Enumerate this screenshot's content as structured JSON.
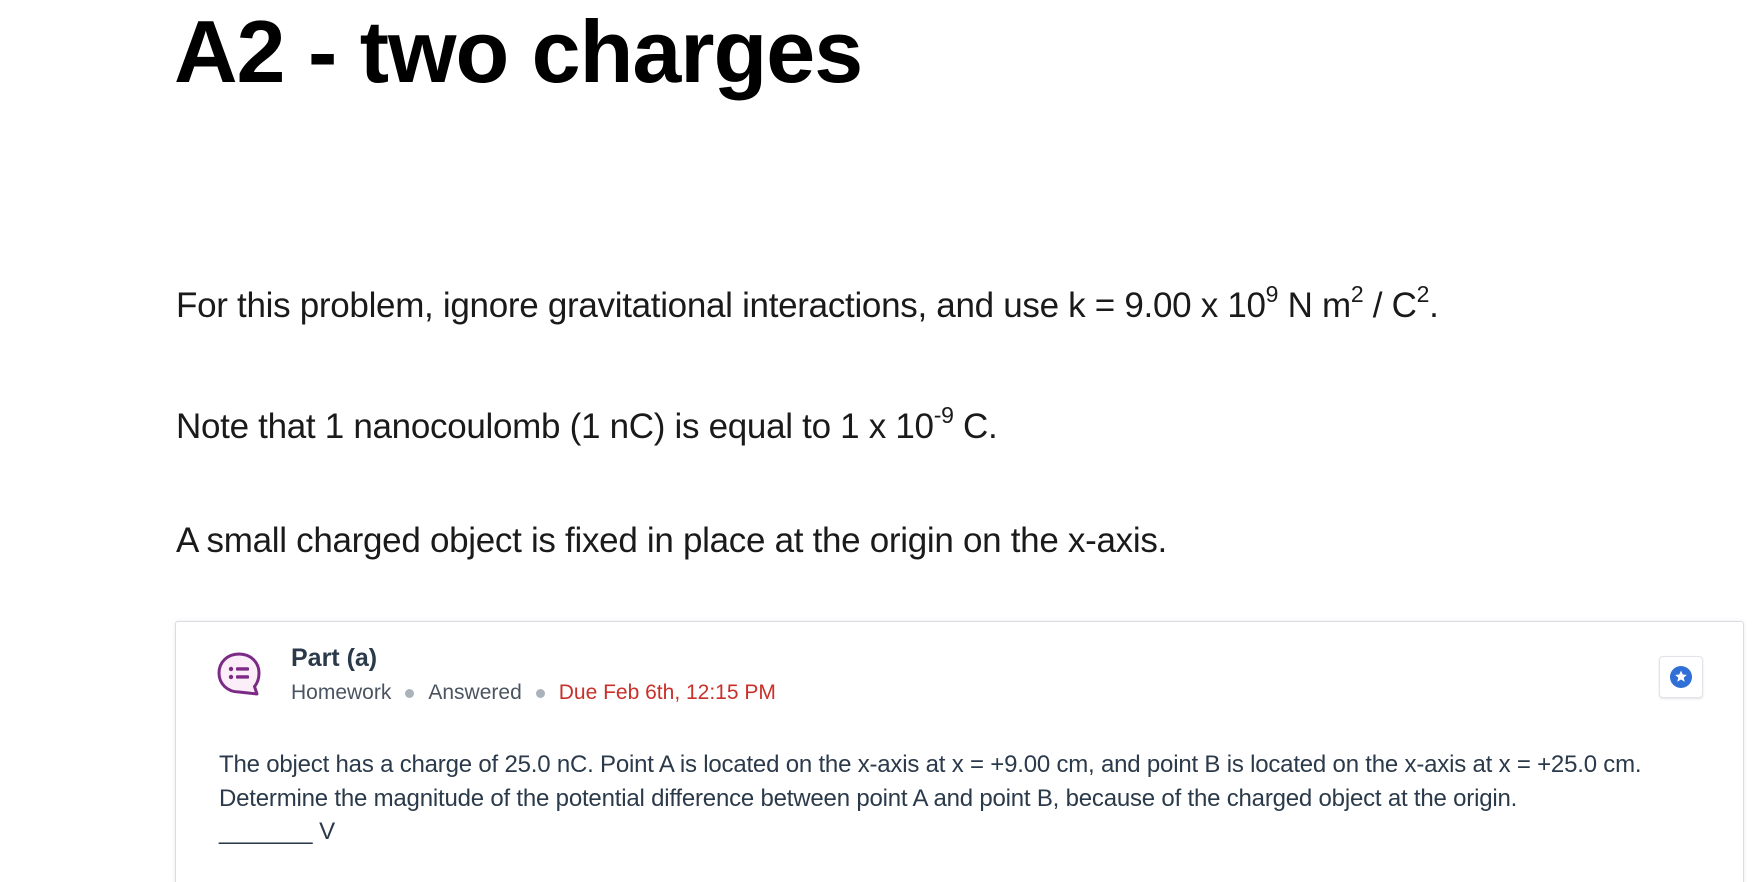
{
  "page": {
    "title": "A2 - two charges",
    "intro": {
      "p1_text": "For this problem, ignore gravitational interactions, and use k = 9.00 x 10",
      "p1_exp1": "9",
      "p1_mid": " N m",
      "p1_exp2": "2",
      "p1_mid2": " / C",
      "p1_exp3": "2",
      "p1_end": ".",
      "p2_text": "Note that 1 nanocoulomb (1 nC) is equal to 1 x 10",
      "p2_exp": "-9",
      "p2_end": " C.",
      "p3_text": "A small charged object is fixed in place at the origin on the x-axis."
    }
  },
  "part": {
    "title": "Part (a)",
    "type": "Homework",
    "status": "Answered",
    "due": "Due Feb 6th, 12:15 PM",
    "icon": "question-bubble-icon",
    "star_icon": "star-badge-icon",
    "question": "The object has a charge of 25.0 nC. Point A is located on the x-axis at x = +9.00 cm, and point B is located on the x-axis at x = +25.0 cm. Determine the magnitude of the potential difference between point A and point B, because of the charged object at the origin.",
    "answer_blank": "_______",
    "answer_unit": " V"
  },
  "colors": {
    "due": "#c8302a",
    "icon_purple": "#7b2a85",
    "star_blue": "#2f6fd6",
    "text_dark": "#2b3a4a"
  }
}
